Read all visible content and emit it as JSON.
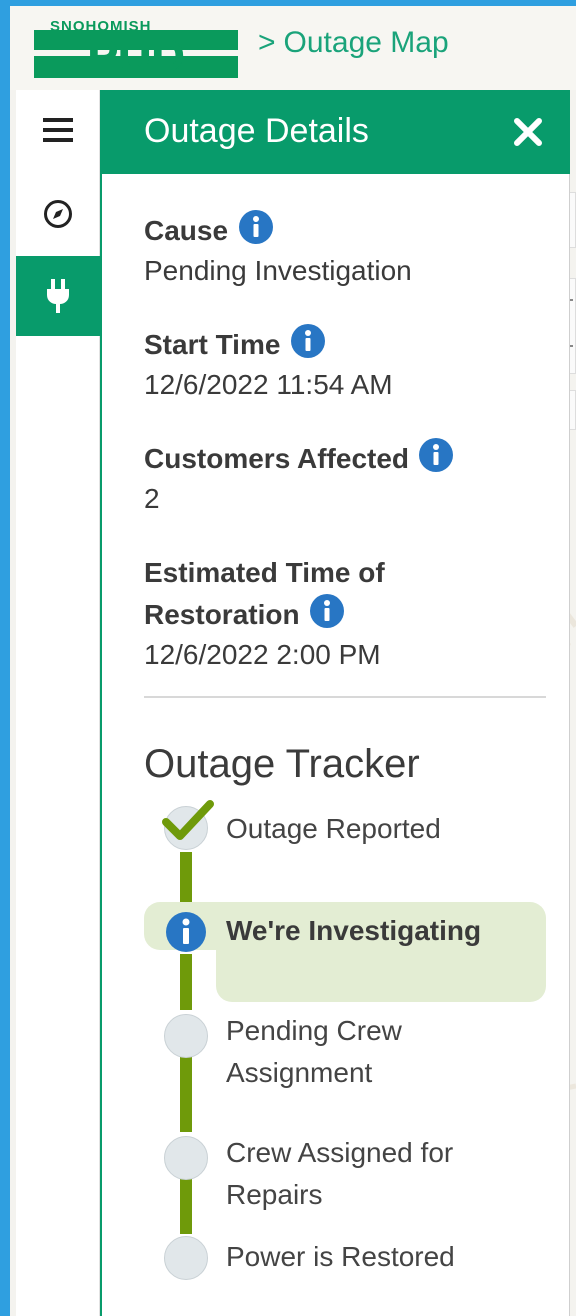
{
  "header": {
    "logo_top": "SNOHOMISH",
    "logo_main": "PUD",
    "breadcrumb_sep": ">",
    "breadcrumb_page": "Outage Map"
  },
  "rail": {
    "items": [
      {
        "icon": "hamburger-menu-icon"
      },
      {
        "icon": "compass-icon"
      },
      {
        "icon": "power-plug-icon",
        "active": true
      }
    ]
  },
  "panel": {
    "title": "Outage Details",
    "fields": [
      {
        "label": "Cause",
        "value": "Pending Investigation"
      },
      {
        "label": "Start Time",
        "value": "12/6/2022 11:54 AM"
      },
      {
        "label": "Customers Affected",
        "value": "2"
      },
      {
        "label_line1": "Estimated Time of",
        "label_line2": "Restoration",
        "value": "12/6/2022 2:00 PM"
      }
    ]
  },
  "tracker": {
    "title": "Outage Tracker",
    "steps": [
      {
        "label": "Outage Reported",
        "status": "complete"
      },
      {
        "label": "We're Investigating",
        "status": "current"
      },
      {
        "label_line1": "Pending Crew",
        "label_line2": "Assignment",
        "status": "pending"
      },
      {
        "label_line1": "Crew Assigned for",
        "label_line2": "Repairs",
        "status": "pending"
      },
      {
        "label": "Power is Restored",
        "status": "pending"
      }
    ]
  },
  "colors": {
    "brand_green": "#089b6b",
    "info_blue": "#2876c4",
    "tracker_line": "#6f9a0a",
    "highlight": "#e3edd3"
  }
}
